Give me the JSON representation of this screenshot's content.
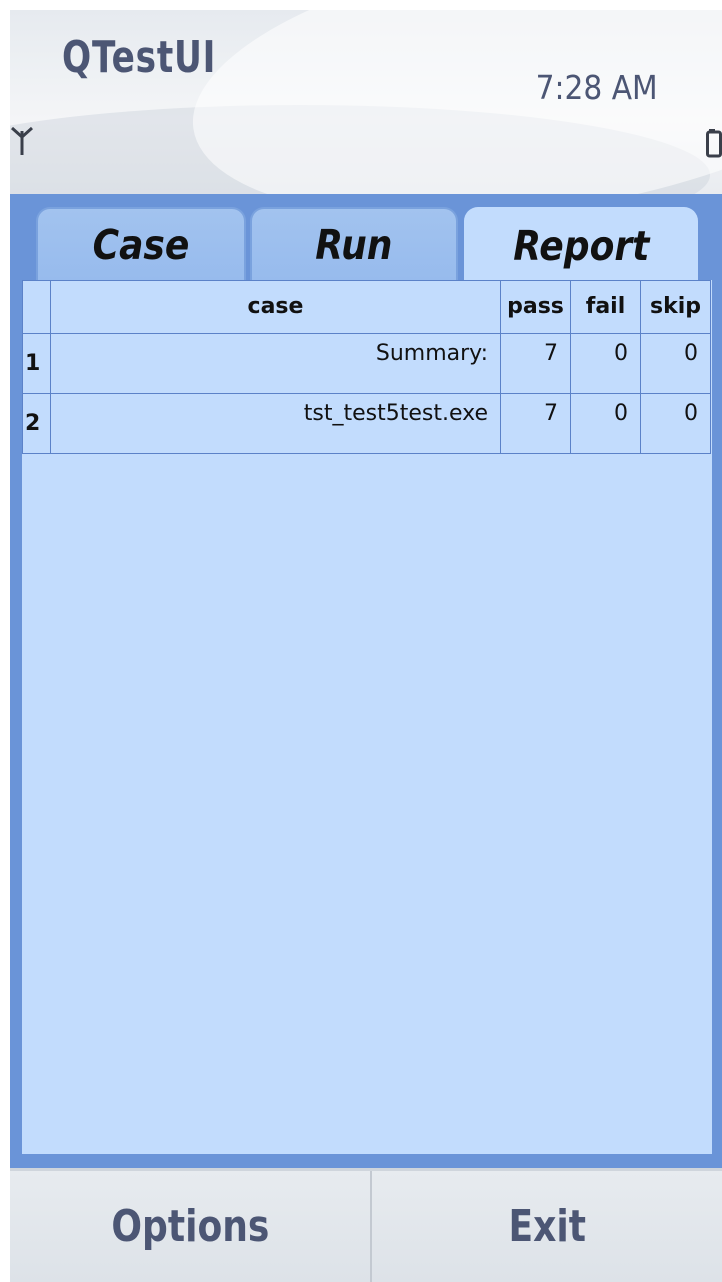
{
  "statusbar": {
    "app_title": "QTestUI",
    "time": "7:28 AM",
    "signal_icon": "signal-antenna-icon",
    "battery_icon": "battery-icon"
  },
  "tabs": [
    {
      "label": "Case",
      "active": false
    },
    {
      "label": "Run",
      "active": false
    },
    {
      "label": "Report",
      "active": true
    }
  ],
  "report_table": {
    "columns": [
      "case",
      "pass",
      "fail",
      "skip"
    ],
    "rows": [
      {
        "num": "1",
        "case": "Summary:",
        "pass": "7",
        "fail": "0",
        "skip": "0"
      },
      {
        "num": "2",
        "case": "tst_test5test.exe",
        "pass": "7",
        "fail": "0",
        "skip": "0"
      }
    ]
  },
  "softkeys": {
    "left": "Options",
    "right": "Exit"
  },
  "colors": {
    "accent": "#6a94d8",
    "panel": "#c2dcfd",
    "tab_inactive": "#9fc1ee",
    "text_primary": "#4c5674"
  }
}
